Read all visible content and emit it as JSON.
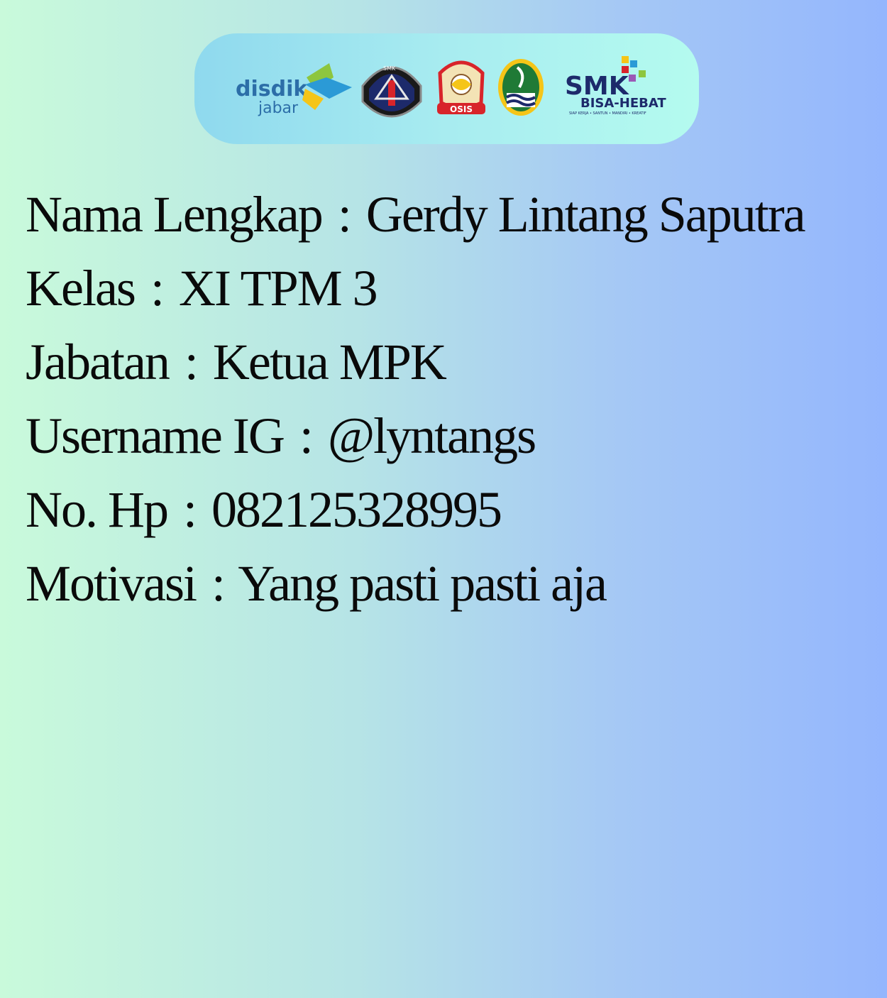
{
  "logos": {
    "disdik_line1": "disdik",
    "disdik_line2": "jabar",
    "smk_badge_text": "SMK",
    "osis_badge_text": "OSIS",
    "smk_hebat_line1": "SMK",
    "smk_hebat_line2": "BISA-HEBAT",
    "smk_hebat_tagline": "SIAP KERJA • SANTUN • MANDIRI • KREATIF",
    "colors": {
      "disdik_text": "#2c6ea8",
      "disdik_green": "#8dc63f",
      "disdik_blue": "#2b9ad6",
      "disdik_yellow": "#f5c518",
      "smk_navy": "#1d2a6b",
      "osis_red": "#d8242a",
      "jabar_green": "#1f7a36"
    }
  },
  "profile": {
    "nama_label": "Nama Lengkap",
    "nama_value": "Gerdy Lintang Saputra",
    "kelas_label": "Kelas",
    "kelas_value": "XI TPM 3",
    "jabatan_label": "Jabatan",
    "jabatan_value": "Ketua MPK",
    "username_label": "Username IG",
    "username_value": "@lyntangs",
    "hp_label": "No. Hp",
    "hp_value": "082125328995",
    "motivasi_label": "Motivasi",
    "motivasi_value": "Yang pasti pasti aja",
    "separator": ":"
  }
}
